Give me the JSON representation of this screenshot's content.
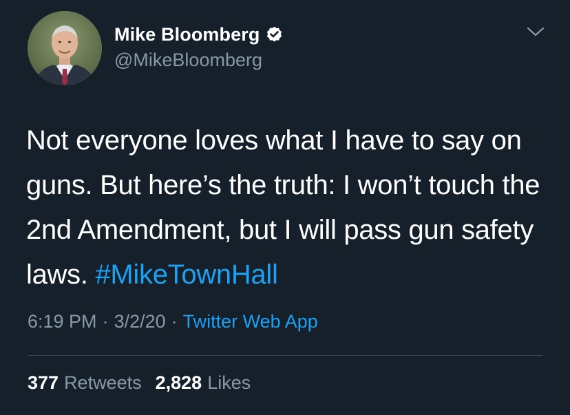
{
  "user": {
    "display_name": "Mike Bloomberg",
    "handle": "@MikeBloomberg",
    "verified_icon": "verified-badge-icon",
    "avatar_icon": "profile-avatar"
  },
  "menu": {
    "caret_icon": "chevron-down-icon"
  },
  "tweet": {
    "text_parts": [
      "Not everyone loves what I have to say on guns. But here’s the truth: I won’t touch the 2nd Amendment, but I will pass gun safety laws.",
      "#MikeTownHall"
    ],
    "time": "6:19 PM",
    "separator": "·",
    "date": "3/2/20",
    "source": "Twitter Web App"
  },
  "stats": {
    "retweets_count": "377",
    "retweets_label": "Retweets",
    "likes_count": "2,828",
    "likes_label": "Likes"
  },
  "colors": {
    "background": "#15202b",
    "primary_text": "#ffffff",
    "secondary_text": "#8899a6",
    "accent": "#1da1f2",
    "divider": "#38444d"
  }
}
